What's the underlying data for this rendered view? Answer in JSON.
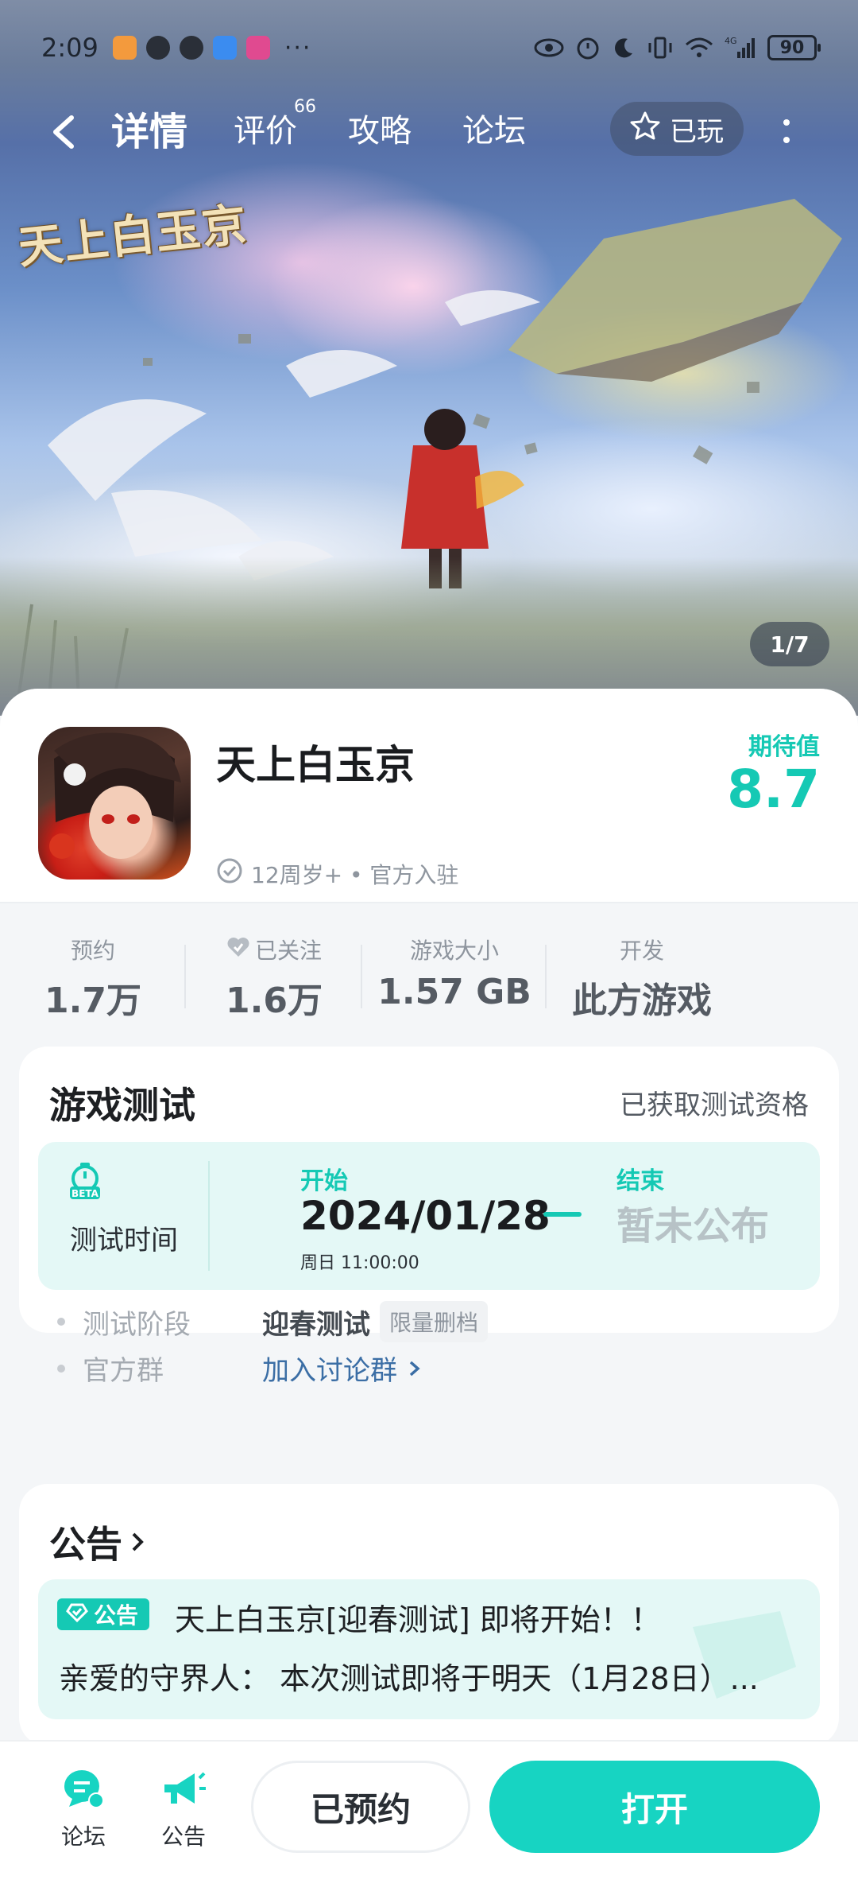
{
  "status_bar": {
    "time": "2:09",
    "overflow": "···",
    "network": "4G",
    "battery": "90",
    "app_icons": [
      "taobao-icon",
      "qq-icon",
      "messages-icon",
      "cloud-icon",
      "video-icon"
    ]
  },
  "nav": {
    "tabs": [
      {
        "label": "详情",
        "active": true
      },
      {
        "label": "评价",
        "badge": "66"
      },
      {
        "label": "攻略"
      },
      {
        "label": "论坛"
      }
    ],
    "played_label": "已玩"
  },
  "banner": {
    "logo_text": "天上白玉京",
    "pager": "1/7"
  },
  "game": {
    "title": "天上白玉京",
    "meta": "12周岁+ • 官方入驻",
    "expect_label": "期待值",
    "expect_score": "8.7"
  },
  "stats": [
    {
      "label": "预约",
      "value": "1.7万"
    },
    {
      "label": "已关注",
      "value": "1.6万",
      "icon": "heart-check-icon"
    },
    {
      "label": "游戏大小",
      "value": "1.57 GB"
    },
    {
      "label": "开发",
      "value": "此方游戏"
    }
  ],
  "test": {
    "title": "游戏测试",
    "status": "已获取测试资格",
    "time_label": "测试时间",
    "beta_badge": "BETA",
    "start_label": "开始",
    "start_date": "2024/01/28",
    "start_detail": "周日  11:00:00",
    "end_label": "结束",
    "end_value": "暂未公布",
    "stage_label": "测试阶段",
    "stage_value": "迎春测试",
    "stage_tag": "限量删档",
    "group_label": "官方群",
    "group_link": "加入讨论群"
  },
  "notice": {
    "title": "公告",
    "tag": "公告",
    "headline": "天上白玉京[迎春测试] 即将开始！！",
    "body": "亲爱的守界人：  本次测试即将于明天（1月28日）..."
  },
  "bottom": {
    "forum_label": "论坛",
    "notice_label": "公告",
    "reserved_label": "已预约",
    "open_label": "打开"
  },
  "colors": {
    "accent": "#17d4c2",
    "accent_text": "#15c9b4",
    "link": "#3b6ea5"
  }
}
